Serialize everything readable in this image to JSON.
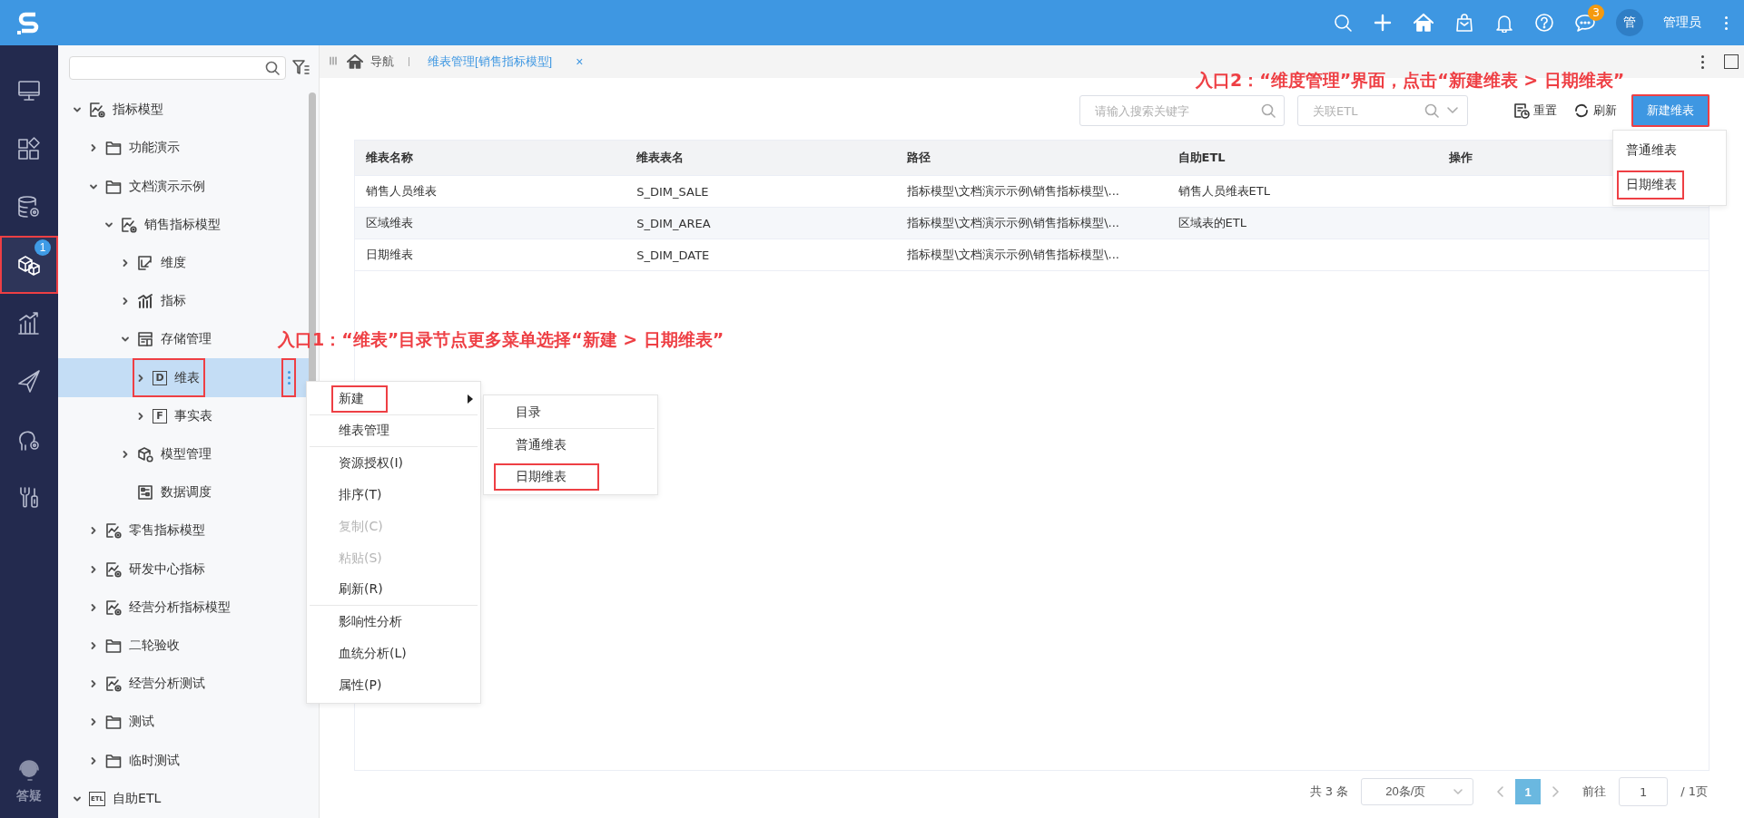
{
  "top_bar": {
    "icons": [
      {
        "kind": "search"
      },
      {
        "kind": "plus"
      },
      {
        "kind": "home"
      },
      {
        "kind": "bag"
      },
      {
        "kind": "bell"
      },
      {
        "kind": "help"
      },
      {
        "kind": "chat",
        "badge": "3"
      }
    ],
    "avatar": "管",
    "user": "管理员"
  },
  "rail": {
    "items": [
      {
        "kind": "monitor",
        "selected": false,
        "highlighted": false
      },
      {
        "kind": "apps",
        "selected": false,
        "highlighted": false
      },
      {
        "kind": "database",
        "selected": false,
        "highlighted": false
      },
      {
        "kind": "cube",
        "selected": true,
        "highlighted": true,
        "badge": "1"
      },
      {
        "kind": "chart",
        "selected": false,
        "highlighted": false
      },
      {
        "kind": "send",
        "selected": false,
        "highlighted": false
      },
      {
        "kind": "person",
        "selected": false,
        "highlighted": false
      },
      {
        "kind": "tools",
        "selected": false,
        "highlighted": false
      }
    ],
    "help_label": "答疑"
  },
  "tree": {
    "items": [
      {
        "label": "指标模型",
        "kind": "model",
        "expanded": true,
        "selected": false,
        "children": [
          {
            "label": "功能演示",
            "kind": "folder",
            "expanded": false,
            "selected": false
          },
          {
            "label": "文档演示示例",
            "kind": "folder",
            "expanded": true,
            "selected": false,
            "children": [
              {
                "label": "销售指标模型",
                "kind": "model",
                "expanded": true,
                "selected": false,
                "children": [
                  {
                    "label": "维度",
                    "kind": "dimension",
                    "expanded": false,
                    "selected": false
                  },
                  {
                    "label": "指标",
                    "kind": "metric",
                    "expanded": false,
                    "selected": false
                  },
                  {
                    "label": "存储管理",
                    "kind": "storage",
                    "expanded": true,
                    "selected": false,
                    "children": [
                      {
                        "label": "维表",
                        "kind": "letter",
                        "letter": "D",
                        "expanded": false,
                        "selected": true,
                        "highlighted": true,
                        "more_button": {
                          "highlighted": true
                        }
                      },
                      {
                        "label": "事实表",
                        "kind": "letter",
                        "letter": "F",
                        "expanded": false,
                        "selected": false
                      }
                    ]
                  },
                  {
                    "label": "模型管理",
                    "kind": "cube",
                    "expanded": false,
                    "selected": false
                  },
                  {
                    "label": "数据调度",
                    "kind": "schedule",
                    "selected": false
                  }
                ]
              }
            ]
          },
          {
            "label": "零售指标模型",
            "kind": "model",
            "expanded": false,
            "selected": false
          },
          {
            "label": "研发中心指标",
            "kind": "model",
            "expanded": false,
            "selected": false
          },
          {
            "label": "经营分析指标模型",
            "kind": "model",
            "expanded": false,
            "selected": false
          },
          {
            "label": "二轮验收",
            "kind": "folder",
            "expanded": false,
            "selected": false
          },
          {
            "label": "经营分析测试",
            "kind": "model",
            "expanded": false,
            "selected": false
          },
          {
            "label": "测试",
            "kind": "folder",
            "expanded": false,
            "selected": false
          },
          {
            "label": "临时测试",
            "kind": "folder",
            "expanded": false,
            "selected": false
          }
        ]
      },
      {
        "label": "自助ETL",
        "kind": "etl",
        "letter": "ETL",
        "expanded": true,
        "selected": false
      }
    ]
  },
  "context_menu": {
    "items": [
      {
        "label": "新建",
        "submenu": true,
        "highlighted": true,
        "disabled": false,
        "divider_after": true
      },
      {
        "label": "维表管理",
        "submenu": false,
        "highlighted": false,
        "disabled": false,
        "divider_after": true
      },
      {
        "label": "资源授权(I)",
        "submenu": false,
        "highlighted": false,
        "disabled": false,
        "divider_after": false
      },
      {
        "label": "排序(T)",
        "submenu": false,
        "highlighted": false,
        "disabled": false,
        "divider_after": false
      },
      {
        "label": "复制(C)",
        "submenu": false,
        "highlighted": false,
        "disabled": true,
        "divider_after": false
      },
      {
        "label": "粘贴(S)",
        "submenu": false,
        "highlighted": false,
        "disabled": true,
        "divider_after": false
      },
      {
        "label": "刷新(R)",
        "submenu": false,
        "highlighted": false,
        "disabled": false,
        "divider_after": true
      },
      {
        "label": "影响性分析",
        "submenu": false,
        "highlighted": false,
        "disabled": false,
        "divider_after": false
      },
      {
        "label": "血统分析(L)",
        "submenu": false,
        "highlighted": false,
        "disabled": false,
        "divider_after": false
      },
      {
        "label": "属性(P)",
        "submenu": false,
        "highlighted": false,
        "disabled": false,
        "divider_after": false
      }
    ],
    "submenu": [
      {
        "label": "目录",
        "highlighted": false,
        "divider_after": true
      },
      {
        "label": "普通维表",
        "highlighted": false,
        "divider_after": false
      },
      {
        "label": "日期维表",
        "highlighted": true,
        "divider_after": false
      }
    ]
  },
  "tab_bar": {
    "nav_label": "导航",
    "tabs": [
      {
        "label": "维表管理[销售指标模型]",
        "selected": true,
        "close": "×"
      }
    ]
  },
  "toolbar": {
    "search_placeholder": "请输入搜索关键字",
    "etl_placeholder": "关联ETL",
    "reset": "重置",
    "refresh": "刷新",
    "create": {
      "label": "新建维表",
      "highlighted": true
    },
    "create_menu": [
      {
        "label": "普通维表",
        "highlighted": false
      },
      {
        "label": "日期维表",
        "highlighted": true
      }
    ]
  },
  "table": {
    "columns": [
      "维表名称",
      "维表表名",
      "路径",
      "自助ETL",
      "操作"
    ],
    "rows": [
      {
        "cells": [
          "销售人员维表",
          "S_DIM_SALE",
          "指标模型\\文档演示示例\\销售指标模型\\...",
          "销售人员维表ETL",
          ""
        ]
      },
      {
        "cells": [
          "区域维表",
          "S_DIM_AREA",
          "指标模型\\文档演示示例\\销售指标模型\\...",
          "区域表的ETL",
          ""
        ]
      },
      {
        "cells": [
          "日期维表",
          "S_DIM_DATE",
          "指标模型\\文档演示示例\\销售指标模型\\...",
          "",
          ""
        ]
      }
    ]
  },
  "pagination": {
    "total": "共 3 条",
    "page_size": "20条/页",
    "pages": [
      {
        "label": "1",
        "selected": true
      }
    ],
    "goto_label": "前往",
    "goto_value": "1",
    "page_count": "/ 1页"
  },
  "annotations": [
    {
      "text": "入口1：“维表”目录节点更多菜单选择“新建 > 日期维表”"
    },
    {
      "text": "入口2：“维度管理”界面，点击“新建维表 > 日期维表”"
    }
  ]
}
